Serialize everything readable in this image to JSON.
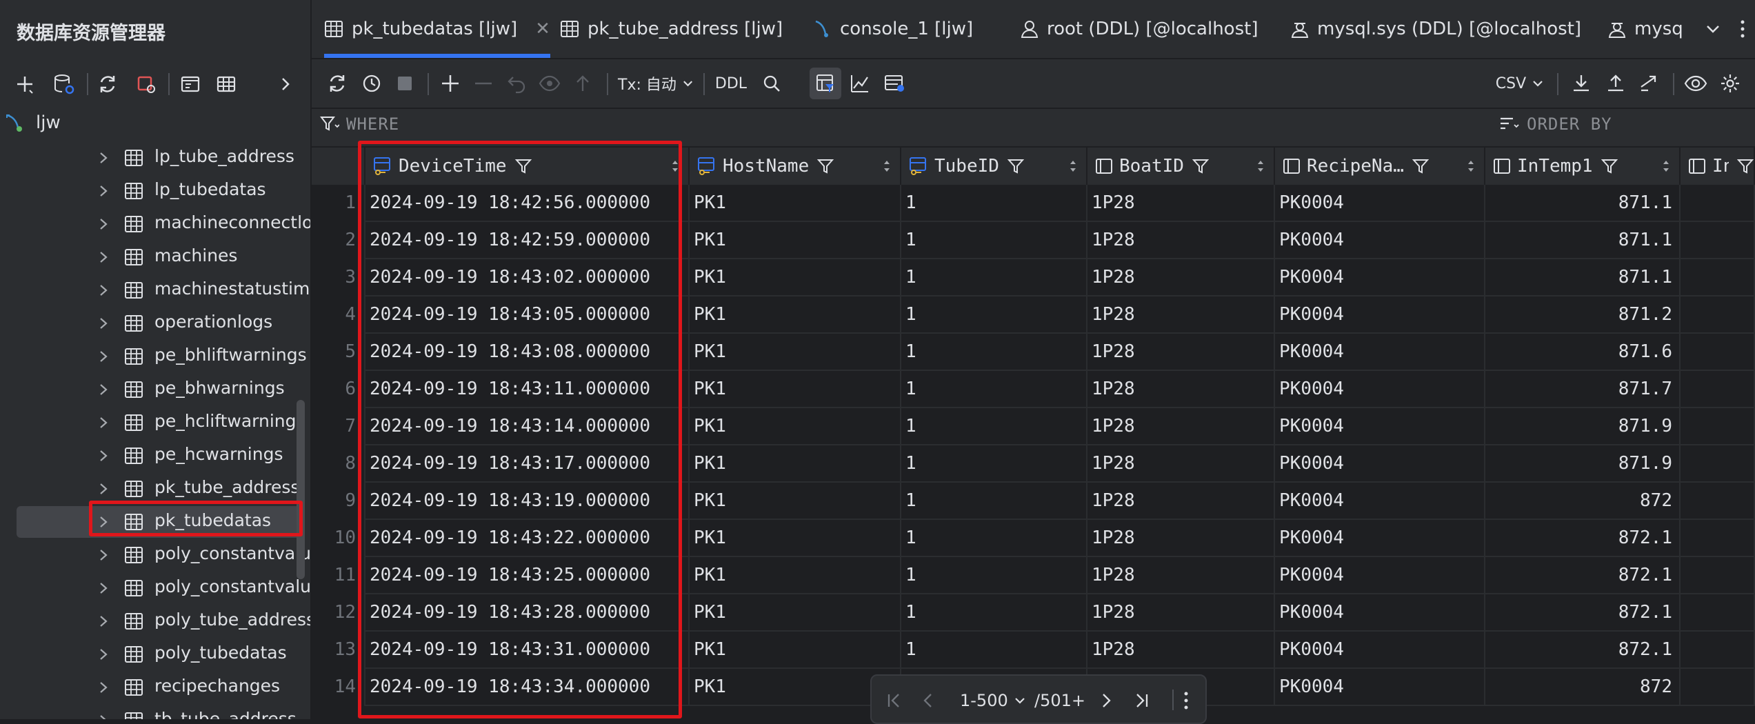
{
  "sidebar": {
    "title": "数据库资源管理器",
    "root": {
      "label": "ljw"
    },
    "items": [
      {
        "label": "lp_tube_address"
      },
      {
        "label": "lp_tubedatas"
      },
      {
        "label": "machineconnectlog"
      },
      {
        "label": "machines"
      },
      {
        "label": "machinestatustime"
      },
      {
        "label": "operationlogs"
      },
      {
        "label": "pe_bhliftwarnings"
      },
      {
        "label": "pe_bhwarnings"
      },
      {
        "label": "pe_hcliftwarnings"
      },
      {
        "label": "pe_hcwarnings"
      },
      {
        "label": "pk_tube_address"
      },
      {
        "label": "pk_tubedatas"
      },
      {
        "label": "poly_constantvalue"
      },
      {
        "label": "poly_constantvalues"
      },
      {
        "label": "poly_tube_address"
      },
      {
        "label": "poly_tubedatas"
      },
      {
        "label": "recipechanges"
      },
      {
        "label": "tb_tube_address"
      }
    ],
    "selected_label": "pk_tubedatas"
  },
  "tabs": [
    {
      "label": "pk_tubedatas [ljw]",
      "active": true,
      "icon": "table-icon"
    },
    {
      "label": "pk_tube_address [ljw]",
      "active": false,
      "icon": "table-icon"
    },
    {
      "label": "console_1 [ljw]",
      "active": false,
      "icon": "console-icon"
    },
    {
      "label": "root (DDL) [@localhost]",
      "active": false,
      "icon": "user-icon"
    },
    {
      "label": "mysql.sys (DDL) [@localhost]",
      "active": false,
      "icon": "user-icon"
    },
    {
      "label": "mysq",
      "active": false,
      "icon": "user-icon"
    }
  ],
  "toolbar": {
    "tx_label": "Tx: 自动",
    "ddl_label": "DDL",
    "export_format": "CSV"
  },
  "filter": {
    "where_placeholder": "WHERE",
    "orderby_placeholder": "ORDER BY"
  },
  "grid": {
    "columns": [
      {
        "name": "DeviceTime",
        "key_icon": true
      },
      {
        "name": "HostName",
        "key_icon": true
      },
      {
        "name": "TubeID",
        "key_icon": true
      },
      {
        "name": "BoatID",
        "key_icon": false
      },
      {
        "name": "RecipeNa…",
        "key_icon": false
      },
      {
        "name": "InTemp1",
        "key_icon": false
      },
      {
        "name": "InT",
        "key_icon": false
      }
    ],
    "rows": [
      {
        "n": "1",
        "time": "2024-09-19 18:42:56.000000",
        "host": "PK1",
        "tube": "1",
        "boat": "1P28",
        "recipe": "PK0004",
        "temp": "871.1"
      },
      {
        "n": "2",
        "time": "2024-09-19 18:42:59.000000",
        "host": "PK1",
        "tube": "1",
        "boat": "1P28",
        "recipe": "PK0004",
        "temp": "871.1"
      },
      {
        "n": "3",
        "time": "2024-09-19 18:43:02.000000",
        "host": "PK1",
        "tube": "1",
        "boat": "1P28",
        "recipe": "PK0004",
        "temp": "871.1"
      },
      {
        "n": "4",
        "time": "2024-09-19 18:43:05.000000",
        "host": "PK1",
        "tube": "1",
        "boat": "1P28",
        "recipe": "PK0004",
        "temp": "871.2"
      },
      {
        "n": "5",
        "time": "2024-09-19 18:43:08.000000",
        "host": "PK1",
        "tube": "1",
        "boat": "1P28",
        "recipe": "PK0004",
        "temp": "871.6"
      },
      {
        "n": "6",
        "time": "2024-09-19 18:43:11.000000",
        "host": "PK1",
        "tube": "1",
        "boat": "1P28",
        "recipe": "PK0004",
        "temp": "871.7"
      },
      {
        "n": "7",
        "time": "2024-09-19 18:43:14.000000",
        "host": "PK1",
        "tube": "1",
        "boat": "1P28",
        "recipe": "PK0004",
        "temp": "871.9"
      },
      {
        "n": "8",
        "time": "2024-09-19 18:43:17.000000",
        "host": "PK1",
        "tube": "1",
        "boat": "1P28",
        "recipe": "PK0004",
        "temp": "871.9"
      },
      {
        "n": "9",
        "time": "2024-09-19 18:43:19.000000",
        "host": "PK1",
        "tube": "1",
        "boat": "1P28",
        "recipe": "PK0004",
        "temp": "872"
      },
      {
        "n": "10",
        "time": "2024-09-19 18:43:22.000000",
        "host": "PK1",
        "tube": "1",
        "boat": "1P28",
        "recipe": "PK0004",
        "temp": "872.1"
      },
      {
        "n": "11",
        "time": "2024-09-19 18:43:25.000000",
        "host": "PK1",
        "tube": "1",
        "boat": "1P28",
        "recipe": "PK0004",
        "temp": "872.1"
      },
      {
        "n": "12",
        "time": "2024-09-19 18:43:28.000000",
        "host": "PK1",
        "tube": "1",
        "boat": "1P28",
        "recipe": "PK0004",
        "temp": "872.1"
      },
      {
        "n": "13",
        "time": "2024-09-19 18:43:31.000000",
        "host": "PK1",
        "tube": "1",
        "boat": "1P28",
        "recipe": "PK0004",
        "temp": "872.1"
      },
      {
        "n": "14",
        "time": "2024-09-19 18:43:34.000000",
        "host": "PK1",
        "tube": "",
        "boat": "",
        "recipe": "PK0004",
        "temp": "872"
      }
    ]
  },
  "paginator": {
    "range": "1-500",
    "total": "/501+"
  },
  "colors": {
    "accent": "#3574f0",
    "highlight": "#e0161b",
    "panel": "#2b2d30",
    "background": "#1e1f22"
  }
}
